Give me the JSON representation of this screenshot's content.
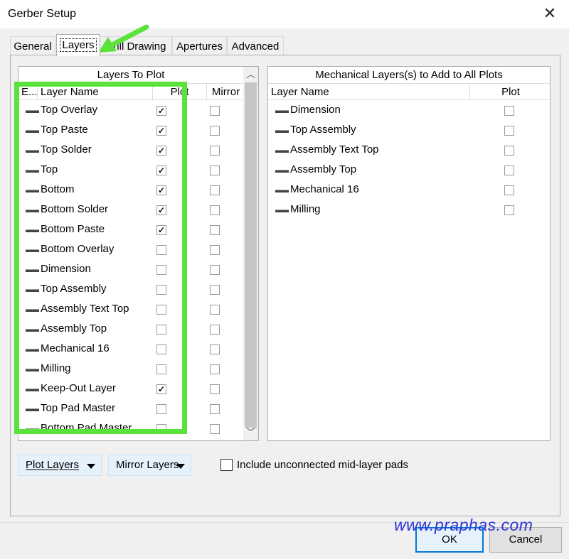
{
  "window": {
    "title": "Gerber Setup"
  },
  "tabs": [
    {
      "label": "General"
    },
    {
      "label": "Layers",
      "active": true
    },
    {
      "label": "Drill Drawing"
    },
    {
      "label": "Apertures"
    },
    {
      "label": "Advanced"
    }
  ],
  "layers_to_plot": {
    "group_header": "Layers To Plot",
    "columns": {
      "extension": "E...",
      "layer_name": "Layer Name",
      "plot": "Plot",
      "mirror": "Mirror"
    },
    "rows": [
      {
        "name": "Top Overlay",
        "plot": true,
        "mirror": false
      },
      {
        "name": "Top Paste",
        "plot": true,
        "mirror": false
      },
      {
        "name": "Top Solder",
        "plot": true,
        "mirror": false
      },
      {
        "name": "Top",
        "plot": true,
        "mirror": false
      },
      {
        "name": "Bottom",
        "plot": true,
        "mirror": false
      },
      {
        "name": "Bottom Solder",
        "plot": true,
        "mirror": false
      },
      {
        "name": "Bottom Paste",
        "plot": true,
        "mirror": false
      },
      {
        "name": "Bottom Overlay",
        "plot": false,
        "mirror": false
      },
      {
        "name": "Dimension",
        "plot": false,
        "mirror": false
      },
      {
        "name": "Top Assembly",
        "plot": false,
        "mirror": false
      },
      {
        "name": "Assembly Text Top",
        "plot": false,
        "mirror": false
      },
      {
        "name": "Assembly Top",
        "plot": false,
        "mirror": false
      },
      {
        "name": "Mechanical 16",
        "plot": false,
        "mirror": false
      },
      {
        "name": "Milling",
        "plot": false,
        "mirror": false
      },
      {
        "name": "Keep-Out Layer",
        "plot": true,
        "mirror": false
      },
      {
        "name": "Top Pad Master",
        "plot": false,
        "mirror": false
      },
      {
        "name": "Bottom Pad Master",
        "plot": false,
        "mirror": false
      }
    ]
  },
  "mechanical_layers": {
    "group_header": "Mechanical Layers(s) to Add to All Plots",
    "columns": {
      "layer_name": "Layer Name",
      "plot": "Plot"
    },
    "rows": [
      {
        "name": "Dimension",
        "plot": false
      },
      {
        "name": "Top Assembly",
        "plot": false
      },
      {
        "name": "Assembly Text Top",
        "plot": false
      },
      {
        "name": "Assembly Top",
        "plot": false
      },
      {
        "name": "Mechanical 16",
        "plot": false
      },
      {
        "name": "Milling",
        "plot": false
      }
    ]
  },
  "buttons": {
    "plot_layers": "Plot Layers",
    "mirror_layers": "Mirror Layers",
    "ok": "OK",
    "cancel": "Cancel"
  },
  "options": {
    "include_unconnected_label": "Include unconnected mid-layer pads",
    "include_unconnected_checked": false
  },
  "watermark": "www.praphas.com",
  "colors": {
    "highlight": "#5be33b",
    "watermark": "#2d33d6",
    "accent": "#0078d7"
  }
}
